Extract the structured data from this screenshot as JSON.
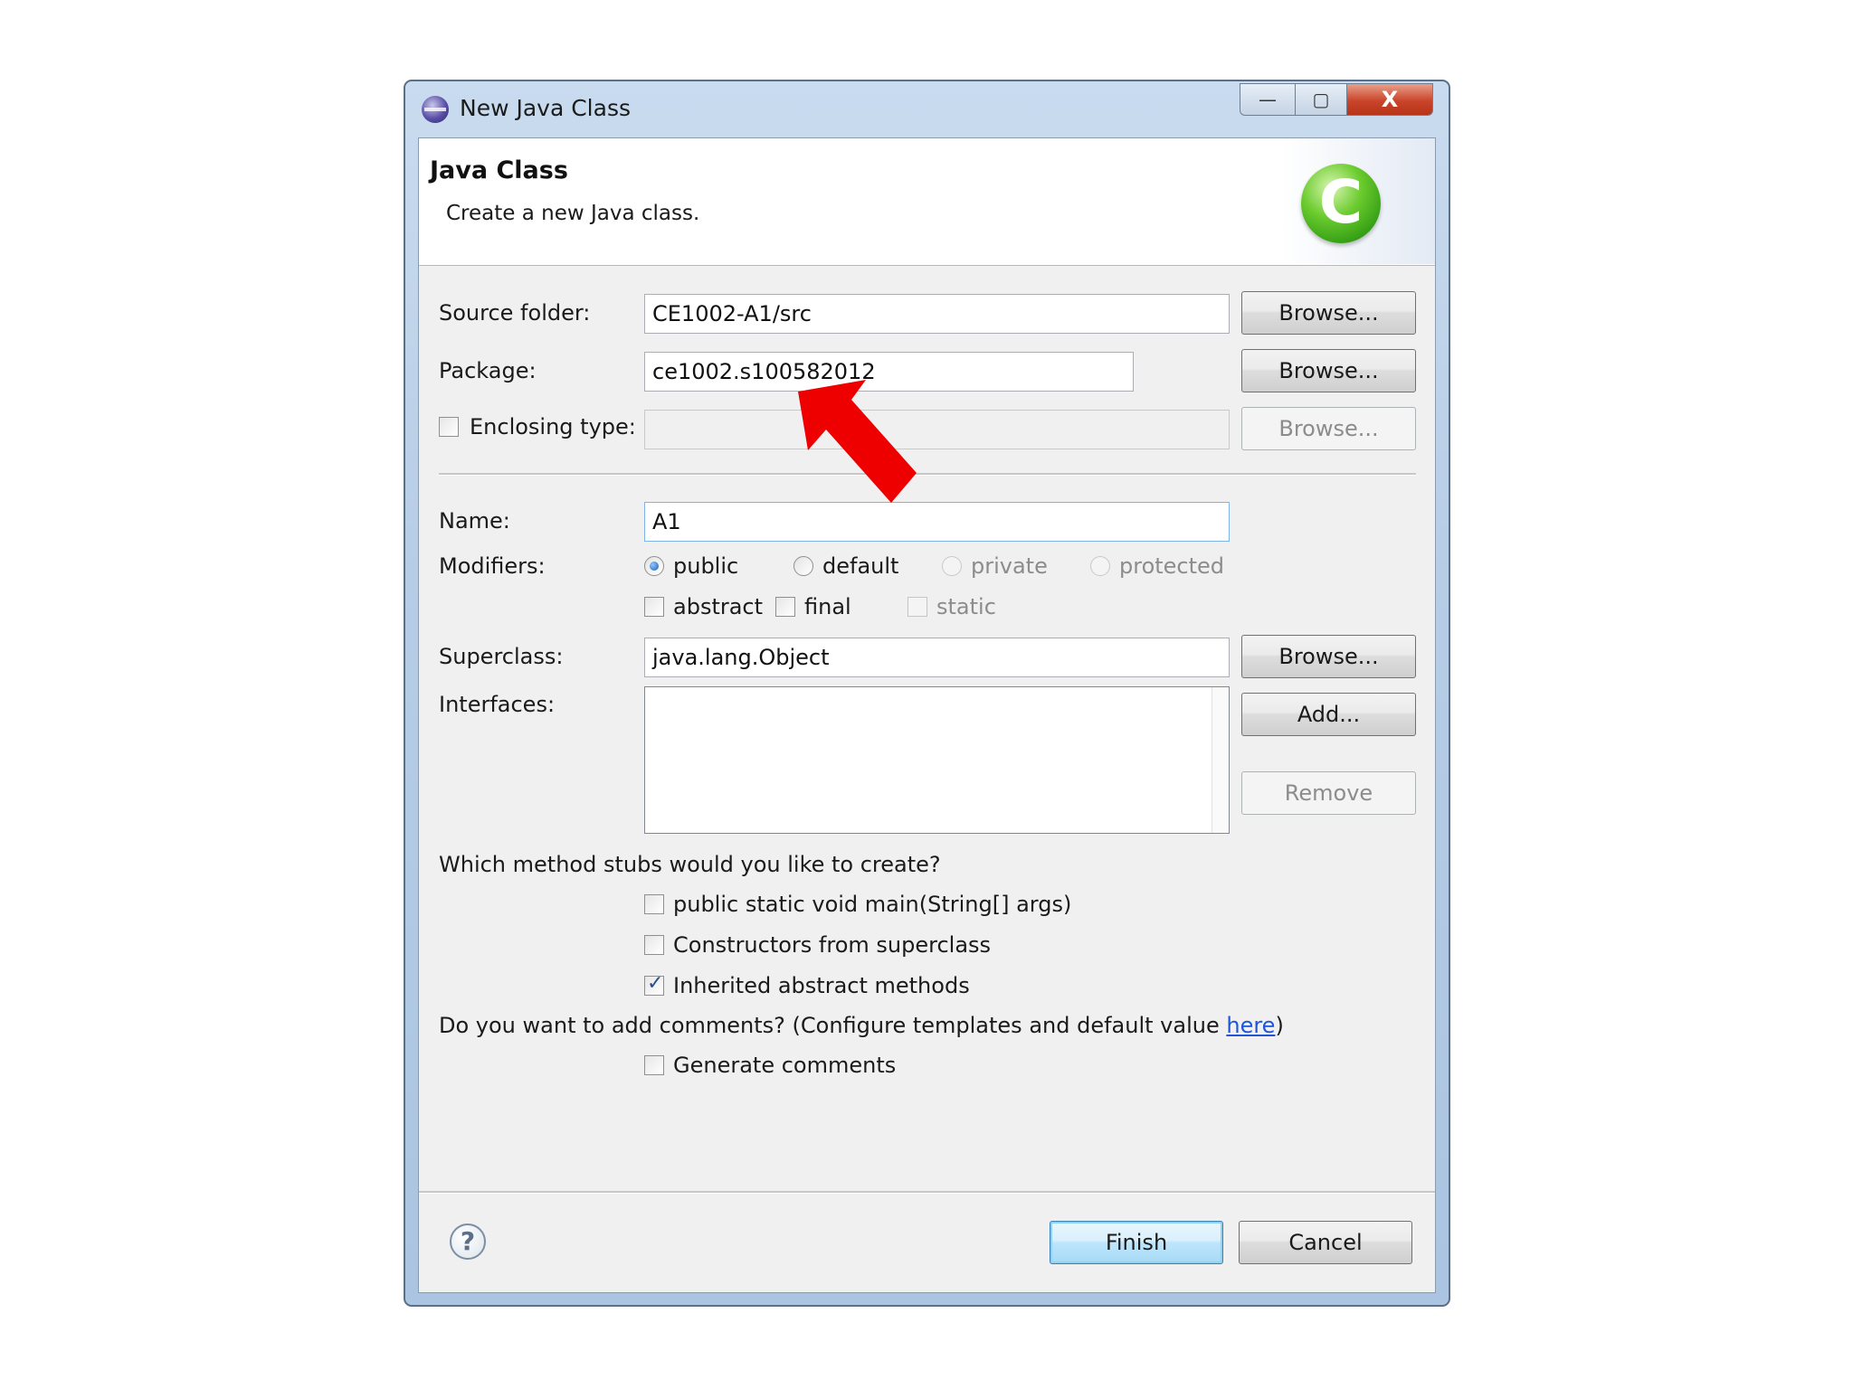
{
  "window": {
    "title": "New Java Class",
    "minimize_glyph": "—",
    "maximize_glyph": "▢",
    "close_glyph": "X"
  },
  "banner": {
    "title": "Java Class",
    "description": "Create a new Java class.",
    "logo_letter": "C",
    "logo_icon": "java-class-icon"
  },
  "form": {
    "source_folder": {
      "label": "Source folder:",
      "value": "CE1002-A1/src",
      "browse": "Browse..."
    },
    "package": {
      "label": "Package:",
      "value": "ce1002.s100582012",
      "browse": "Browse..."
    },
    "enclosing_type": {
      "label": "Enclosing type:",
      "value": "",
      "browse": "Browse...",
      "checked": false
    },
    "name": {
      "label": "Name:",
      "value": "A1"
    },
    "modifiers": {
      "label": "Modifiers:",
      "radios": [
        {
          "label": "public",
          "checked": true,
          "enabled": true
        },
        {
          "label": "default",
          "checked": false,
          "enabled": true
        },
        {
          "label": "private",
          "checked": false,
          "enabled": false
        },
        {
          "label": "protected",
          "checked": false,
          "enabled": false
        }
      ],
      "checks": [
        {
          "label": "abstract",
          "checked": false,
          "enabled": true
        },
        {
          "label": "final",
          "checked": false,
          "enabled": true
        },
        {
          "label": "static",
          "checked": false,
          "enabled": false
        }
      ]
    },
    "superclass": {
      "label": "Superclass:",
      "value": "java.lang.Object",
      "browse": "Browse..."
    },
    "interfaces": {
      "label": "Interfaces:",
      "add": "Add...",
      "remove": "Remove",
      "items": []
    },
    "stubs": {
      "question": "Which method stubs would you like to create?",
      "options": [
        {
          "label": "public static void main(String[] args)",
          "checked": false
        },
        {
          "label": "Constructors from superclass",
          "checked": false
        },
        {
          "label": "Inherited abstract methods",
          "checked": true
        }
      ]
    },
    "comments": {
      "question_prefix": "Do you want to add comments? (Configure templates and default value ",
      "link": "here",
      "question_suffix": ")",
      "option": {
        "label": "Generate comments",
        "checked": false
      }
    }
  },
  "footer": {
    "help_glyph": "?",
    "finish": "Finish",
    "cancel": "Cancel"
  },
  "annotation": {
    "color": "#ee0000",
    "icon": "red-arrow-pointer"
  }
}
